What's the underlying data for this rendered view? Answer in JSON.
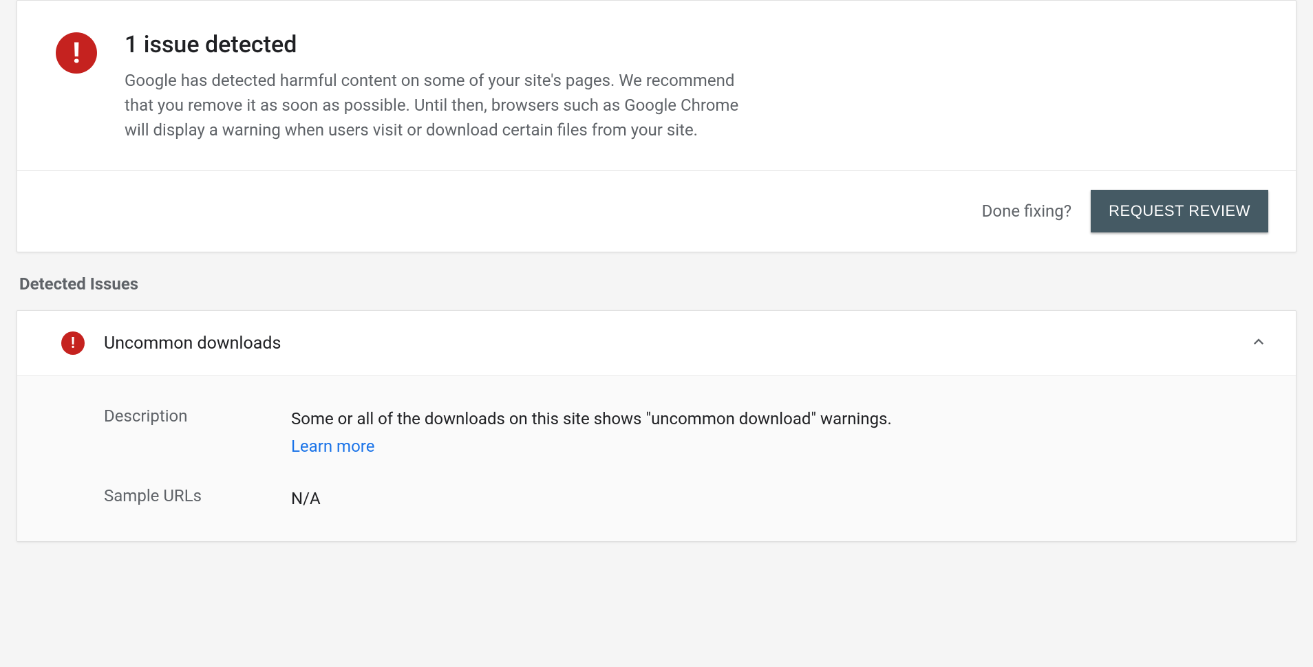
{
  "alert": {
    "icon": "!",
    "title": "1 issue detected",
    "description": "Google has detected harmful content on some of your site's pages. We recommend that you remove it as soon as possible. Until then, browsers such as Google Chrome will display a warning when users visit or download certain files from your site.",
    "done_fixing_label": "Done fixing?",
    "request_review_label": "REQUEST REVIEW"
  },
  "section_heading": "Detected Issues",
  "issue": {
    "icon": "!",
    "title": "Uncommon downloads",
    "description_label": "Description",
    "description_value": "Some or all of the downloads on this site shows \"uncommon download\" warnings.",
    "learn_more_label": "Learn more",
    "sample_urls_label": "Sample URLs",
    "sample_urls_value": "N/A"
  }
}
